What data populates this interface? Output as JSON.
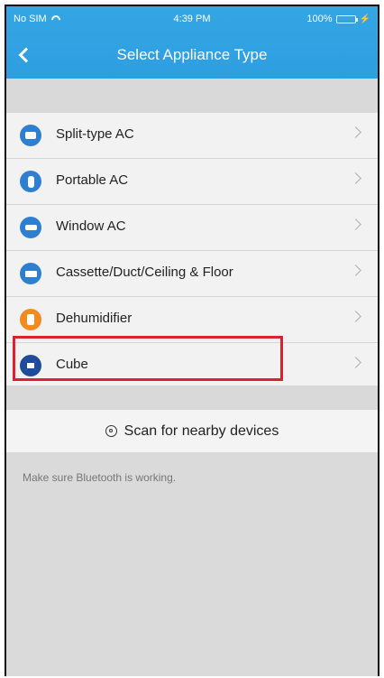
{
  "status_bar": {
    "carrier": "No SIM",
    "time": "4:39 PM",
    "battery": "100%"
  },
  "nav": {
    "title": "Select Appliance Type",
    "back_icon": "chevron-left-icon"
  },
  "appliances": [
    {
      "label": "Split-type AC",
      "icon": "split-ac-icon",
      "color": "#2f7fd0"
    },
    {
      "label": "Portable AC",
      "icon": "portable-ac-icon",
      "color": "#2f7fd0"
    },
    {
      "label": "Window AC",
      "icon": "window-ac-icon",
      "color": "#2f7fd0"
    },
    {
      "label": "Cassette/Duct/Ceiling & Floor",
      "icon": "cassette-icon",
      "color": "#2f7fd0"
    },
    {
      "label": "Dehumidifier",
      "icon": "dehumidifier-icon",
      "color": "#f28b1f"
    },
    {
      "label": "Cube",
      "icon": "cube-icon",
      "color": "#1e4c9b",
      "highlighted": true
    }
  ],
  "scan": {
    "label": "Scan for nearby devices",
    "icon": "scan-icon"
  },
  "hint": "Make sure Bluetooth is working.",
  "colors": {
    "header": "#2d9ee0",
    "highlight_border": "#d9232e",
    "background": "#dcdcdc"
  }
}
